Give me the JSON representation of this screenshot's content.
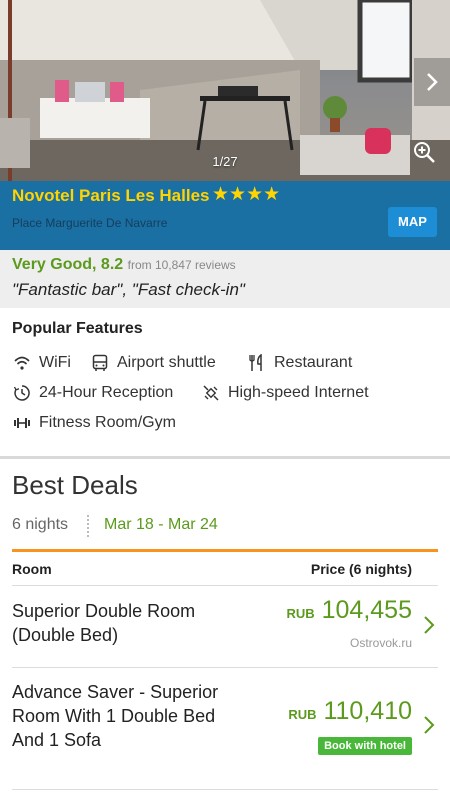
{
  "gallery": {
    "counter": "1/27"
  },
  "hotel": {
    "name": "Novotel Paris Les Halles",
    "stars": "★★★★",
    "star_count": 4,
    "address": "Place Marguerite De Navarre",
    "map_label": "MAP"
  },
  "rating": {
    "label": "Very Good, 8.2",
    "reviews": "from 10,847 reviews",
    "quote": "\"Fantastic bar\", \"Fast check-in\""
  },
  "features": {
    "title": "Popular Features",
    "items": [
      {
        "label": "WiFi",
        "icon": "wifi-icon"
      },
      {
        "label": "Airport shuttle",
        "icon": "bus-icon"
      },
      {
        "label": "Restaurant",
        "icon": "restaurant-icon"
      },
      {
        "label": "24-Hour Reception",
        "icon": "clock-icon"
      },
      {
        "label": "High-speed Internet",
        "icon": "satellite-icon"
      },
      {
        "label": "Fitness Room/Gym",
        "icon": "dumbbell-icon"
      }
    ]
  },
  "deals": {
    "title": "Best Deals",
    "nights": "6 nights",
    "dates": "Mar 18 - Mar 24",
    "col_room": "Room",
    "col_price": "Price (6 nights)",
    "rows": [
      {
        "room": "Superior Double Room (Double Bed)",
        "currency": "RUB",
        "price": "104,455",
        "provider": "Ostrovok.ru"
      },
      {
        "room": "Advance Saver - Superior Room With 1 Double Bed And 1 Sofa",
        "currency": "RUB",
        "price": "110,410",
        "badge": "Book with hotel"
      }
    ]
  },
  "colors": {
    "title_band": "#1a6fa3",
    "hotel_name": "#ffd400",
    "accent_green": "#5c9a1e",
    "divider_orange": "#f7931e",
    "map_button": "#1d8ed6"
  }
}
